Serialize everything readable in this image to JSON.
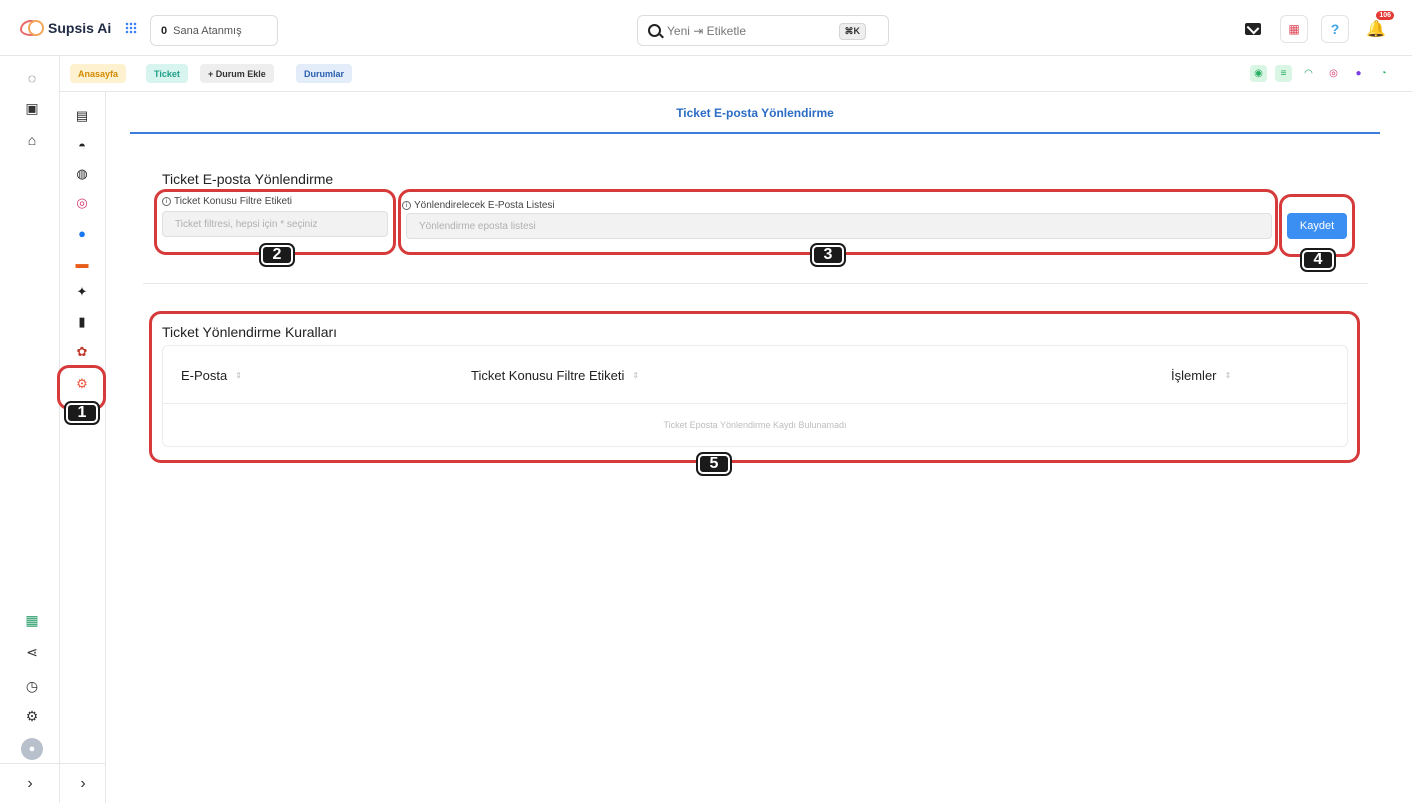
{
  "topbar": {
    "brand": "Supsis Ai",
    "assigned_count": "0",
    "assigned_label": "Sana Atanmış",
    "search_placeholder": "Yeni ⇥ Etiketle",
    "search_shortcut": "⌘K",
    "notification_count": "106"
  },
  "breadcrumbs": {
    "home": "Anasayfa",
    "ticket": "Ticket",
    "add_status": "+ Durum Ekle",
    "statuses": "Durumlar"
  },
  "page": {
    "header": "Ticket E-posta Yönlendirme",
    "form_title": "Ticket E-posta Yönlendirme",
    "filter_label": "Ticket Konusu Filtre Etiketi",
    "filter_placeholder": "Ticket filtresi, hepsi için * seçiniz",
    "email_list_label": "Yönlendirelecek E-Posta Listesi",
    "email_list_placeholder": "Yönlendirme eposta listesi",
    "save_button": "Kaydet"
  },
  "rules": {
    "title": "Ticket Yönlendirme Kuralları",
    "columns": [
      "E-Posta",
      "Ticket Konusu Filtre Etiketi",
      "İşlemler"
    ],
    "empty_text": "Ticket Eposta Yönlendirme Kaydı Bulunamadı"
  },
  "annotations": [
    "1",
    "2",
    "3",
    "4",
    "5"
  ],
  "colors": {
    "accent": "#3b8ff3",
    "header_text": "#2b6cc4",
    "annotation": "#d63a3a"
  }
}
